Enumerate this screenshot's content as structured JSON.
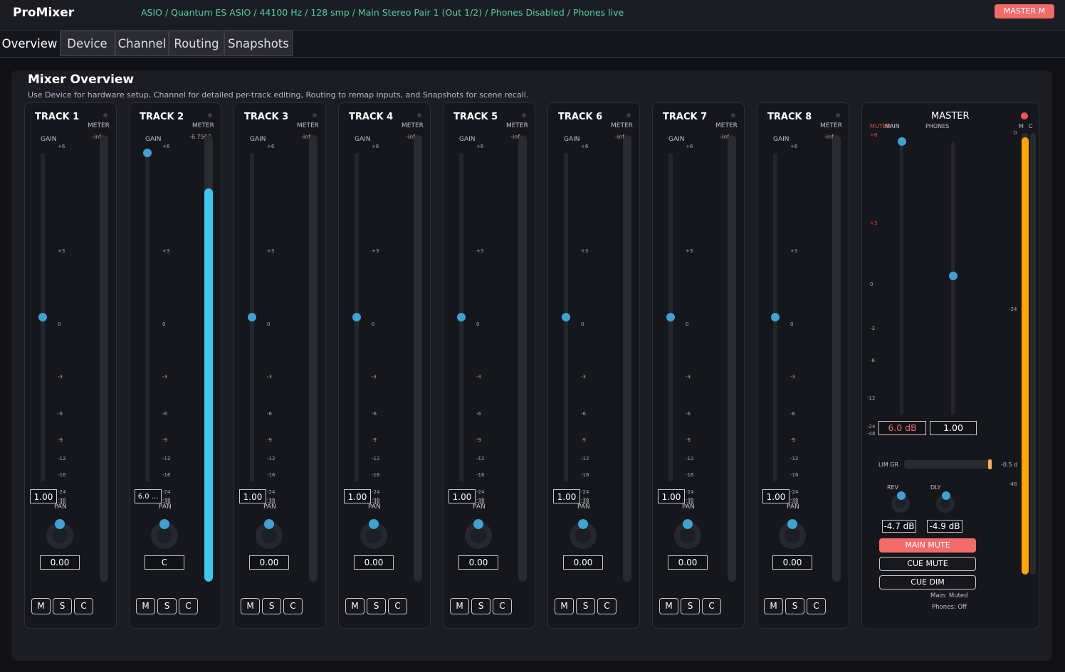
{
  "app": {
    "title": "ProMixer",
    "status": "ASIO / Quantum ES ASIO / 44100 Hz / 128 smp / Main Stereo Pair 1 (Out 1/2) / Phones Disabled / Phones live",
    "master_button": "MASTER M"
  },
  "tabs": [
    "Overview",
    "Device",
    "Channel",
    "Routing",
    "Snapshots"
  ],
  "page": {
    "title": "Mixer Overview",
    "subtitle": "Use Device for hardware setup, Channel for detailed per-track editing, Routing to remap inputs, and Snapshots for scene recall."
  },
  "strip_labels": {
    "meter": "METER",
    "gain": "GAIN",
    "pan": "PAN"
  },
  "scale": [
    "+6",
    "+3",
    "0",
    "-3",
    "-6",
    "-9",
    "-12",
    "-16",
    "-24",
    "-36",
    "-48"
  ],
  "tracks": [
    {
      "name": "TRACK 1",
      "meter_readout": "-inf",
      "meter_level": 0,
      "gain_level": 0.5,
      "gain_value": "1.00",
      "pan_value": "0.00"
    },
    {
      "name": "TRACK 2",
      "meter_readout": "-6.7502",
      "meter_level": 0.88,
      "gain_level": 1.0,
      "gain_value": "6.0 ...",
      "pan_value": "C"
    },
    {
      "name": "TRACK 3",
      "meter_readout": "-inf",
      "meter_level": 0,
      "gain_level": 0.5,
      "gain_value": "1.00",
      "pan_value": "0.00"
    },
    {
      "name": "TRACK 4",
      "meter_readout": "-inf",
      "meter_level": 0,
      "gain_level": 0.5,
      "gain_value": "1.00",
      "pan_value": "0.00"
    },
    {
      "name": "TRACK 5",
      "meter_readout": "-inf",
      "meter_level": 0,
      "gain_level": 0.5,
      "gain_value": "1.00",
      "pan_value": "0.00"
    },
    {
      "name": "TRACK 6",
      "meter_readout": "-inf",
      "meter_level": 0,
      "gain_level": 0.5,
      "gain_value": "1.00",
      "pan_value": "0.00"
    },
    {
      "name": "TRACK 7",
      "meter_readout": "-inf",
      "meter_level": 0,
      "gain_level": 0.5,
      "gain_value": "1.00",
      "pan_value": "0.00"
    },
    {
      "name": "TRACK 8",
      "meter_readout": "-inf",
      "meter_level": 0,
      "gain_level": 0.5,
      "gain_value": "1.00",
      "pan_value": "0.00"
    }
  ],
  "track_buttons": [
    "M",
    "S",
    "C"
  ],
  "master": {
    "title": "MASTER",
    "muted_label": "MUTED",
    "main_label": "MAIN",
    "phones_label": "PHONES",
    "meter_m_label": "M",
    "meter_c_label": "C",
    "scale_left": [
      "+6",
      "+3",
      "0",
      "-3",
      "-6",
      "-12",
      "-24",
      "-48"
    ],
    "meter_scale": [
      "0",
      "-24",
      "-48"
    ],
    "main_level": 0.99,
    "phones_level": 0.51,
    "main_value": "6.0 dB",
    "phones_value": "1.00",
    "lim_label": "LIM GR",
    "lim_value": "-0.5 d",
    "lim_level": 0.98,
    "rev_label": "REV",
    "dly_label": "DLY",
    "rev_value": "-4.7 dB",
    "dly_value": "-4.9 dB",
    "main_mute": "MAIN MUTE",
    "cue_mute": "CUE MUTE",
    "cue_dim": "CUE DIM",
    "main_state": "Main: Muted",
    "phones_state": "Phones: Off",
    "meter_m_level": 0.99,
    "meter_c_level": 0
  },
  "colors": {
    "accent": "#3fa2d2",
    "meter": "#3cc8ee",
    "master_meter": "#ffa500",
    "mute": "#f26b6b",
    "status": "#4fd0a0"
  }
}
